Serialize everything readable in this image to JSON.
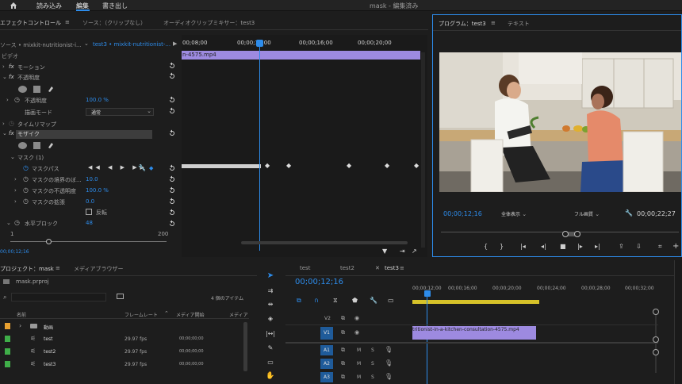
{
  "topbar": {
    "home_icon": "home-icon",
    "menu": [
      "読み込み",
      "編集",
      "書き出し"
    ],
    "active": 1,
    "title": "mask - 編集済み"
  },
  "effect_controls": {
    "tab_label": "エフェクトコントロール",
    "tab_source": "ソース：（クリップなし）",
    "tab_audio_mixer": "オーディオクリップミキサー：test3",
    "source_clip": "ソース • mixkit-nutritionist-i...",
    "seq_clip": "test3 • mixkit-nutritionist-...",
    "timecodes": [
      "00;08;00",
      "00;00;12;00",
      "00;00;16;00",
      "00;00;20;00"
    ],
    "clip_name": "n-4575.mp4",
    "video_header": "ビデオ",
    "motion": "モーション",
    "opacity": "不透明度",
    "opacity_label": "不透明度",
    "opacity_value": "100.0 %",
    "blend_label": "描画モード",
    "blend_value": "通常",
    "time_remap": "タイムリマップ",
    "mosaic": "モザイク",
    "mask_header": "マスク (1)",
    "mask_path": "マスクパス",
    "mask_feather": "マスクの境界のぼ...",
    "mask_feather_value": "10.0",
    "mask_opacity": "マスクの不透明度",
    "mask_opacity_value": "100.0 %",
    "mask_expansion": "マスクの拡張",
    "mask_expansion_value": "0.0",
    "invert_label": "反転",
    "horizontal_blocks": "水平ブロック",
    "horizontal_blocks_value": "48",
    "slider_min": "1",
    "slider_max": "200",
    "bottom_timecode": "00;00;12;16"
  },
  "program": {
    "tab_label": "プログラム：test3",
    "tab_text": "テキスト",
    "timecode": "00;00;12;16",
    "zoom": "全体表示",
    "quality": "フル画質",
    "duration": "00;00;22;27"
  },
  "project": {
    "tab_label": "プロジェクト：mask",
    "tab_media": "メディアブラウザー",
    "file": "mask.prproj",
    "search_placeholder": "",
    "item_count": "4 個のアイテム",
    "columns": [
      "名前",
      "フレームレート",
      "メディア開始",
      "メディア"
    ],
    "rows": [
      {
        "name": "動画",
        "fps": "",
        "start": "",
        "color": "#e8a030",
        "type": "folder"
      },
      {
        "name": "test",
        "fps": "29.97 fps",
        "start": "00;00;00;00",
        "color": "#3fae49",
        "type": "sequence"
      },
      {
        "name": "test2",
        "fps": "29.97 fps",
        "start": "00;00;00;00",
        "color": "#3fae49",
        "type": "sequence"
      },
      {
        "name": "test3",
        "fps": "29.97 fps",
        "start": "00;00;00;00",
        "color": "#3fae49",
        "type": "sequence"
      }
    ]
  },
  "timeline": {
    "tabs": [
      "test",
      "test2",
      "test3"
    ],
    "active_tab": 2,
    "timecode": "00;00;12;16",
    "ruler": [
      "00;00;12;00",
      "00;00;16;00",
      "00;00;20;00",
      "00;00;24;00",
      "00;00;28;00",
      "00;00;32;00"
    ],
    "clip_label": "tritionist-in-a-kitchen-consultation-4575.mp4",
    "clip_fx": "fx",
    "video_tracks": [
      "V2",
      "V1"
    ],
    "audio_tracks": [
      "A1",
      "A2",
      "A3"
    ],
    "track_m": "M",
    "track_s": "S"
  },
  "colors": {
    "accent": "#2d8ceb",
    "clip": "#9d8ae0",
    "workarea": "#d6c229",
    "panel_border": "#2d8ceb"
  }
}
